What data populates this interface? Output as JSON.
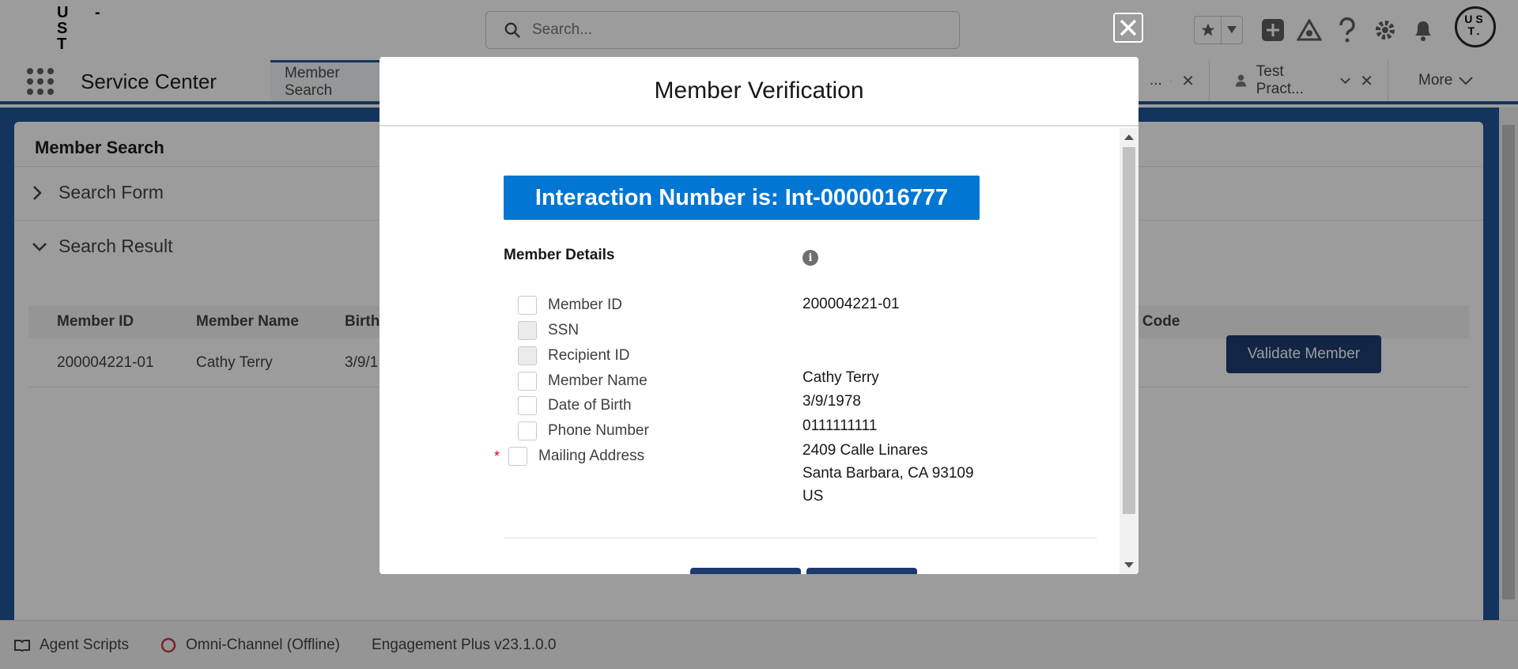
{
  "header": {
    "logo_text": "U - S T",
    "search_placeholder": "Search..."
  },
  "navbar": {
    "app_name": "Service Center",
    "tabs": [
      {
        "label": "Member Search"
      },
      {
        "label": "..."
      },
      {
        "label": "Test Pract..."
      }
    ],
    "more_label": "More"
  },
  "page": {
    "card_title": "Member Search",
    "sections": [
      {
        "label": "Search Form",
        "expanded": false
      },
      {
        "label": "Search Result",
        "expanded": true
      }
    ],
    "table": {
      "headers": [
        "Member ID",
        "Member Name",
        "Birth",
        "p Code"
      ],
      "rows": [
        {
          "member_id": "200004221-01",
          "member_name": "Cathy Terry",
          "birth": "3/9/1"
        }
      ]
    },
    "validate_button": "Validate Member"
  },
  "footer": {
    "items": [
      "Agent Scripts",
      "Omni-Channel (Offline)",
      "Engagement Plus v23.1.0.0"
    ]
  },
  "modal": {
    "title": "Member Verification",
    "interaction_banner": "Interaction Number is: Int-0000016777",
    "details_title": "Member Details",
    "fields": [
      {
        "label": "Member ID",
        "disabled": false,
        "required": false,
        "value": "200004221-01"
      },
      {
        "label": "SSN",
        "disabled": true,
        "required": false,
        "value": ""
      },
      {
        "label": "Recipient ID",
        "disabled": true,
        "required": false,
        "value": ""
      },
      {
        "label": "Member Name",
        "disabled": false,
        "required": false,
        "value": "Cathy Terry"
      },
      {
        "label": "Date of Birth",
        "disabled": false,
        "required": false,
        "value": "3/9/1978"
      },
      {
        "label": "Phone Number",
        "disabled": false,
        "required": false,
        "value": "0111111111"
      },
      {
        "label": "Mailing Address",
        "disabled": false,
        "required": true,
        "value": "2409 Calle Linares"
      }
    ],
    "address_line2": "Santa Barbara, CA 93109",
    "address_line3": "US",
    "required_mark": "*"
  },
  "colors": {
    "brand_blue": "#1b5297",
    "banner_blue": "#0176d3",
    "button_navy": "#1b3a6d",
    "required_red": "#ea001e"
  }
}
